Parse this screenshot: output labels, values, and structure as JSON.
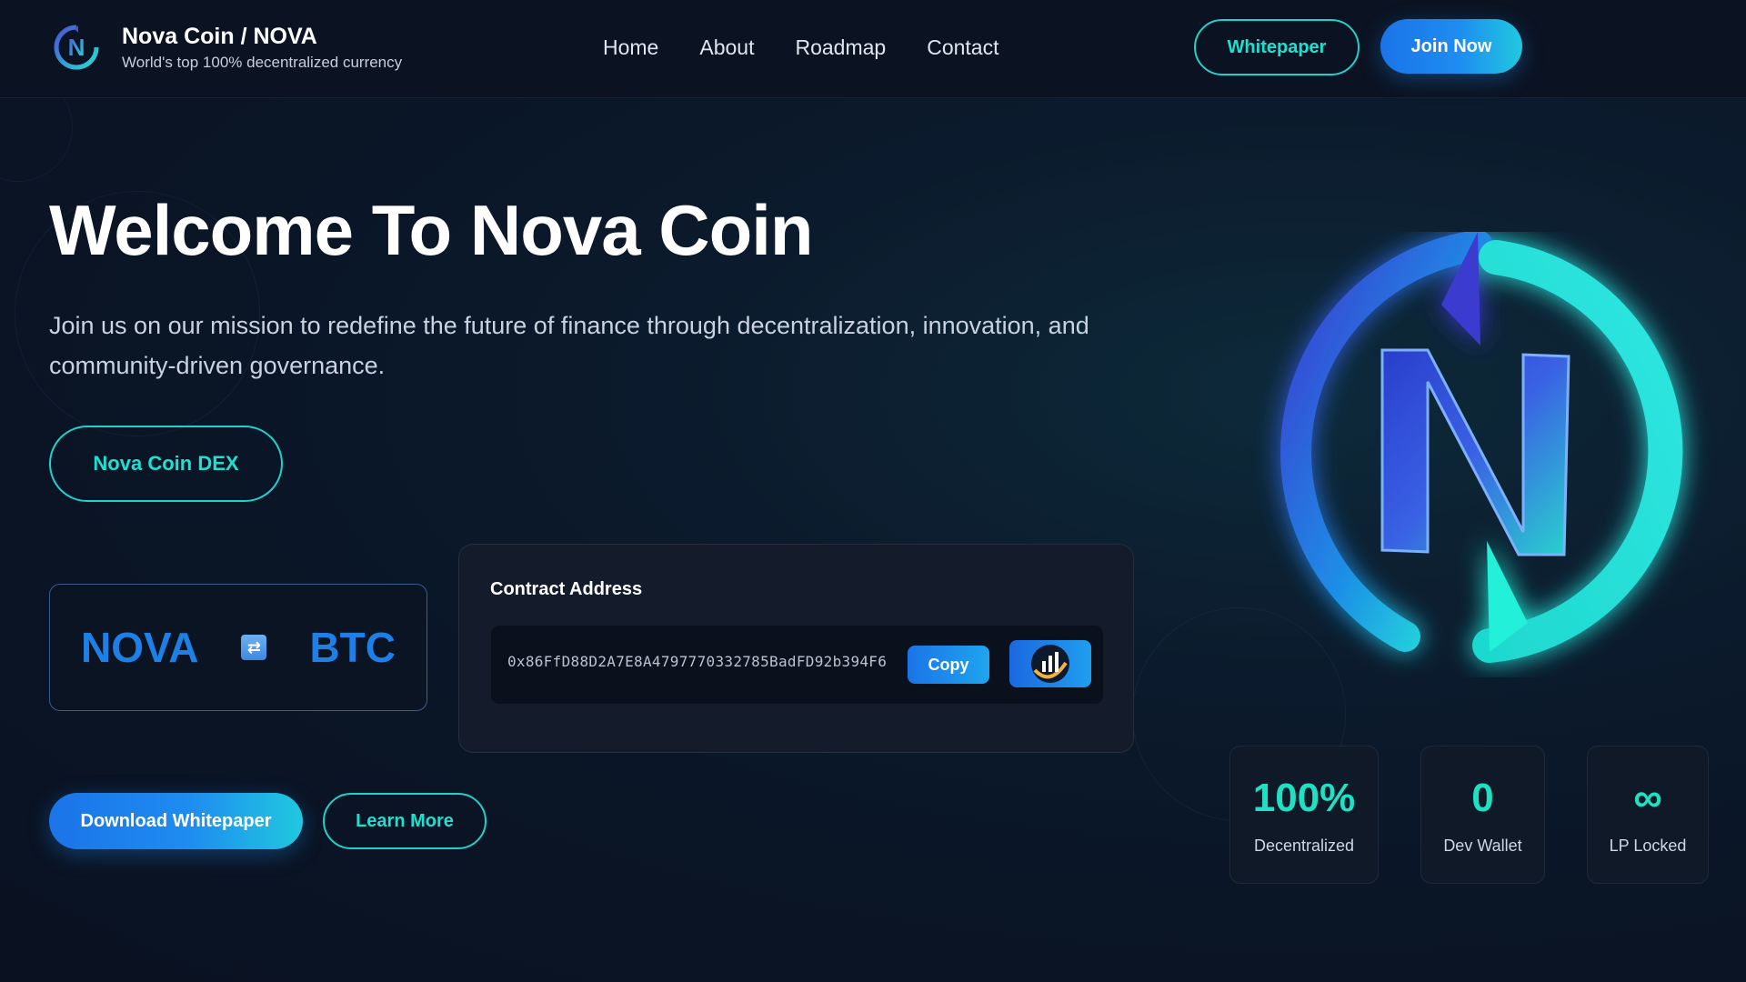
{
  "brand": {
    "title": "Nova Coin / NOVA",
    "subtitle": "World's top 100% decentralized currency",
    "logo_icon": "nova-n-logo-icon",
    "logo_letter": "N"
  },
  "nav": {
    "items": [
      {
        "label": "Home"
      },
      {
        "label": "About"
      },
      {
        "label": "Roadmap"
      },
      {
        "label": "Contact"
      }
    ]
  },
  "header_actions": {
    "whitepaper_label": "Whitepaper",
    "join_label": "Join Now"
  },
  "hero": {
    "title": "Welcome To Nova Coin",
    "subtitle": "Join us on our mission to redefine the future of finance through decentralization, innovation, and community-driven governance.",
    "dex_button_label": "Nova Coin DEX"
  },
  "pair": {
    "base": "NOVA",
    "quote": "BTC",
    "swap_icon": "swap-icon"
  },
  "contract": {
    "label": "Contract Address",
    "address": "0x86FfD88D2A7E8A4797770332785BadFD92b394F6",
    "copy_label": "Copy",
    "chart_icon": "chart-icon"
  },
  "cta": {
    "download_label": "Download Whitepaper",
    "learn_label": "Learn More"
  },
  "stats": [
    {
      "value": "100%",
      "label": "Decentralized"
    },
    {
      "value": "0",
      "label": "Dev Wallet"
    },
    {
      "value": "∞",
      "label": "LP Locked"
    }
  ],
  "hero_logo": {
    "icon": "nova-n-hero-logo",
    "letter": "N"
  },
  "colors": {
    "accent_teal": "#1fe0c2",
    "accent_blue": "#1e7fe6",
    "background": "#0a1424",
    "outline_teal": "#1fd1c9"
  }
}
